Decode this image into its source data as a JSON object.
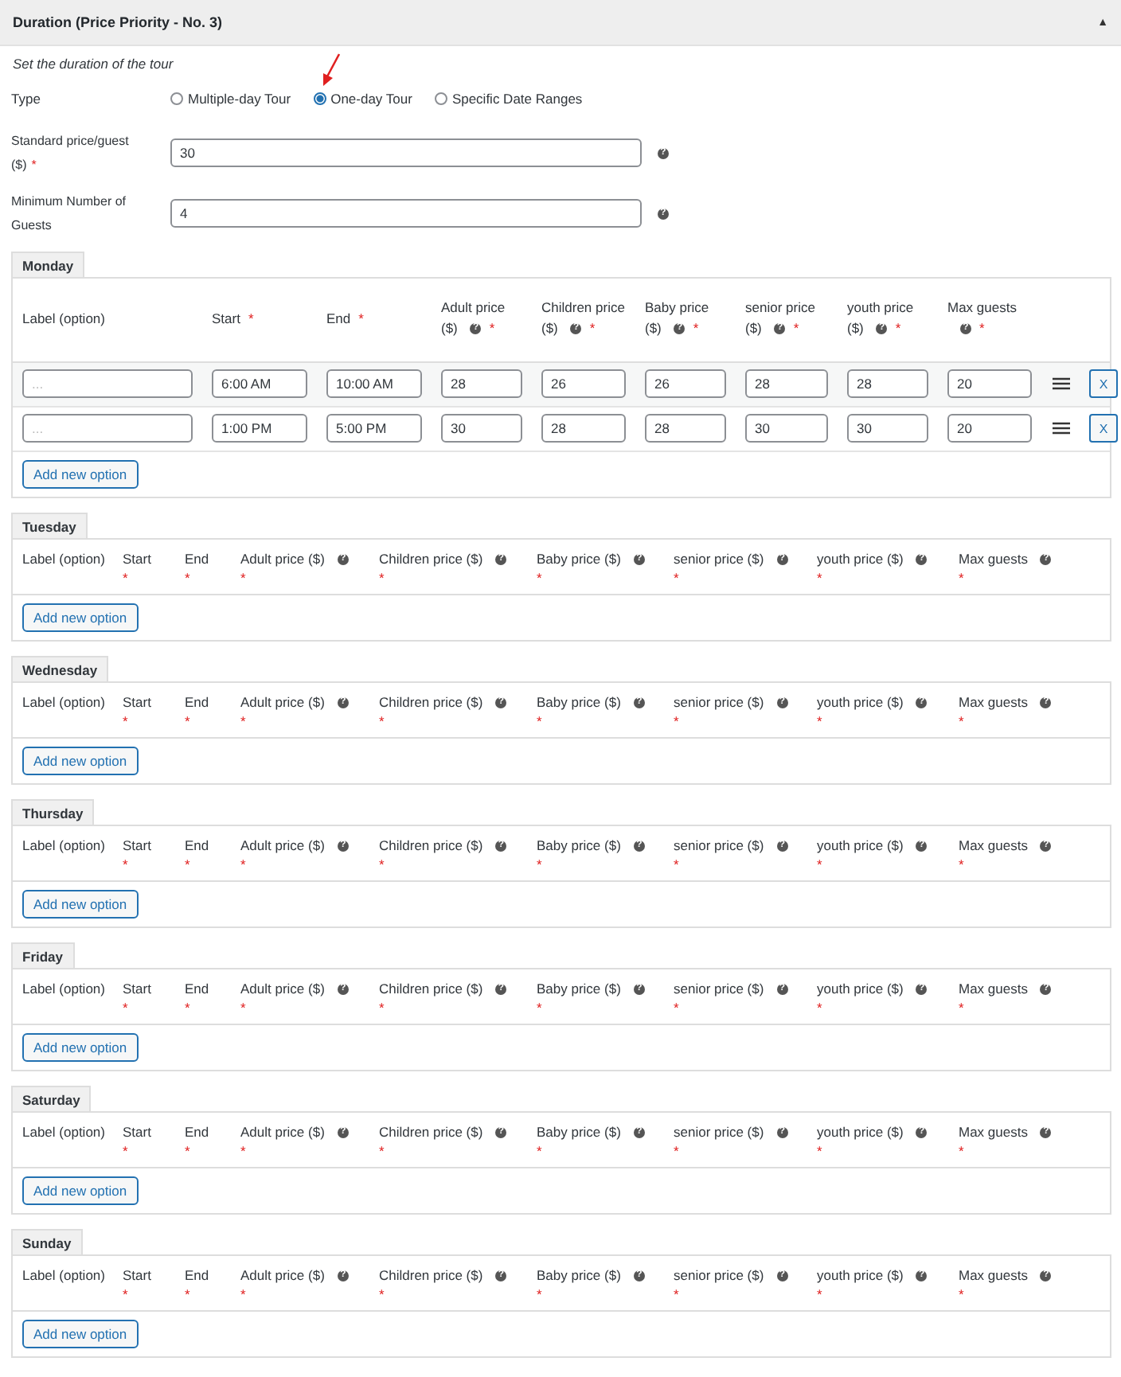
{
  "panel": {
    "title": "Duration (Price Priority - No. 3)",
    "collapse_icon": "▲"
  },
  "description": "Set the duration of the tour",
  "type": {
    "label": "Type",
    "options": [
      {
        "label": "Multiple-day Tour",
        "selected": false
      },
      {
        "label": "One-day Tour",
        "selected": true
      },
      {
        "label": "Specific Date Ranges",
        "selected": false
      }
    ]
  },
  "fields": [
    {
      "label": "Standard price/guest ($)",
      "required": "*",
      "value": "30",
      "help": "?"
    },
    {
      "label": "Minimum Number of Guests",
      "value": "4",
      "help": "?"
    }
  ],
  "days": [
    {
      "name": "Monday",
      "columns": [
        {
          "label": "Label (option)"
        },
        {
          "label": "Start",
          "required": "*"
        },
        {
          "label": "End",
          "required": "*"
        },
        {
          "label": "Adult price ($)",
          "help": "?",
          "required": "*"
        },
        {
          "label": "Children price ($)",
          "help": "?",
          "required": "*"
        },
        {
          "label": "Baby price ($)",
          "help": "?",
          "required": "*"
        },
        {
          "label": "senior price ($)",
          "help": "?",
          "required": "*"
        },
        {
          "label": "youth price ($)",
          "help": "?",
          "required": "*"
        },
        {
          "label": "Max guests",
          "help": "?",
          "required": "*"
        }
      ],
      "rows": [
        {
          "placeholder": "...",
          "cells": [
            "",
            "6:00 AM",
            "10:00 AM",
            "28",
            "26",
            "26",
            "28",
            "28",
            "20"
          ],
          "remove": "X"
        },
        {
          "placeholder": "...",
          "cells": [
            "",
            "1:00 PM",
            "5:00 PM",
            "30",
            "28",
            "28",
            "30",
            "30",
            "20"
          ],
          "remove": "X"
        }
      ],
      "add_button": "Add new option"
    },
    {
      "name": "Tuesday",
      "columns": [
        {
          "label": "Label (option)"
        },
        {
          "label": "Start",
          "required": "*"
        },
        {
          "label": "End",
          "required": "*"
        },
        {
          "label": "Adult price ($)",
          "help": "?",
          "required": "*"
        },
        {
          "label": "Children price ($)",
          "help": "?",
          "required": "*"
        },
        {
          "label": "Baby price ($)",
          "help": "?",
          "required": "*"
        },
        {
          "label": "senior price ($)",
          "help": "?",
          "required": "*"
        },
        {
          "label": "youth price ($)",
          "help": "?",
          "required": "*"
        },
        {
          "label": "Max guests",
          "help": "?",
          "required": "*"
        }
      ],
      "add_button": "Add new option"
    },
    {
      "name": "Wednesday",
      "columns": [
        {
          "label": "Label (option)"
        },
        {
          "label": "Start",
          "required": "*"
        },
        {
          "label": "End",
          "required": "*"
        },
        {
          "label": "Adult price ($)",
          "help": "?",
          "required": "*"
        },
        {
          "label": "Children price ($)",
          "help": "?",
          "required": "*"
        },
        {
          "label": "Baby price ($)",
          "help": "?",
          "required": "*"
        },
        {
          "label": "senior price ($)",
          "help": "?",
          "required": "*"
        },
        {
          "label": "youth price ($)",
          "help": "?",
          "required": "*"
        },
        {
          "label": "Max guests",
          "help": "?",
          "required": "*"
        }
      ],
      "add_button": "Add new option"
    },
    {
      "name": "Thursday",
      "columns": [
        {
          "label": "Label (option)"
        },
        {
          "label": "Start",
          "required": "*"
        },
        {
          "label": "End",
          "required": "*"
        },
        {
          "label": "Adult price ($)",
          "help": "?",
          "required": "*"
        },
        {
          "label": "Children price ($)",
          "help": "?",
          "required": "*"
        },
        {
          "label": "Baby price ($)",
          "help": "?",
          "required": "*"
        },
        {
          "label": "senior price ($)",
          "help": "?",
          "required": "*"
        },
        {
          "label": "youth price ($)",
          "help": "?",
          "required": "*"
        },
        {
          "label": "Max guests",
          "help": "?",
          "required": "*"
        }
      ],
      "add_button": "Add new option"
    },
    {
      "name": "Friday",
      "columns": [
        {
          "label": "Label (option)"
        },
        {
          "label": "Start",
          "required": "*"
        },
        {
          "label": "End",
          "required": "*"
        },
        {
          "label": "Adult price ($)",
          "help": "?",
          "required": "*"
        },
        {
          "label": "Children price ($)",
          "help": "?",
          "required": "*"
        },
        {
          "label": "Baby price ($)",
          "help": "?",
          "required": "*"
        },
        {
          "label": "senior price ($)",
          "help": "?",
          "required": "*"
        },
        {
          "label": "youth price ($)",
          "help": "?",
          "required": "*"
        },
        {
          "label": "Max guests",
          "help": "?",
          "required": "*"
        }
      ],
      "add_button": "Add new option"
    },
    {
      "name": "Saturday",
      "columns": [
        {
          "label": "Label (option)"
        },
        {
          "label": "Start",
          "required": "*"
        },
        {
          "label": "End",
          "required": "*"
        },
        {
          "label": "Adult price ($)",
          "help": "?",
          "required": "*"
        },
        {
          "label": "Children price ($)",
          "help": "?",
          "required": "*"
        },
        {
          "label": "Baby price ($)",
          "help": "?",
          "required": "*"
        },
        {
          "label": "senior price ($)",
          "help": "?",
          "required": "*"
        },
        {
          "label": "youth price ($)",
          "help": "?",
          "required": "*"
        },
        {
          "label": "Max guests",
          "help": "?",
          "required": "*"
        }
      ],
      "add_button": "Add new option"
    },
    {
      "name": "Sunday",
      "columns": [
        {
          "label": "Label (option)"
        },
        {
          "label": "Start",
          "required": "*"
        },
        {
          "label": "End",
          "required": "*"
        },
        {
          "label": "Adult price ($)",
          "help": "?",
          "required": "*"
        },
        {
          "label": "Children price ($)",
          "help": "?",
          "required": "*"
        },
        {
          "label": "Baby price ($)",
          "help": "?",
          "required": "*"
        },
        {
          "label": "senior price ($)",
          "help": "?",
          "required": "*"
        },
        {
          "label": "youth price ($)",
          "help": "?",
          "required": "*"
        },
        {
          "label": "Max guests",
          "help": "?",
          "required": "*"
        }
      ],
      "add_button": "Add new option"
    }
  ]
}
